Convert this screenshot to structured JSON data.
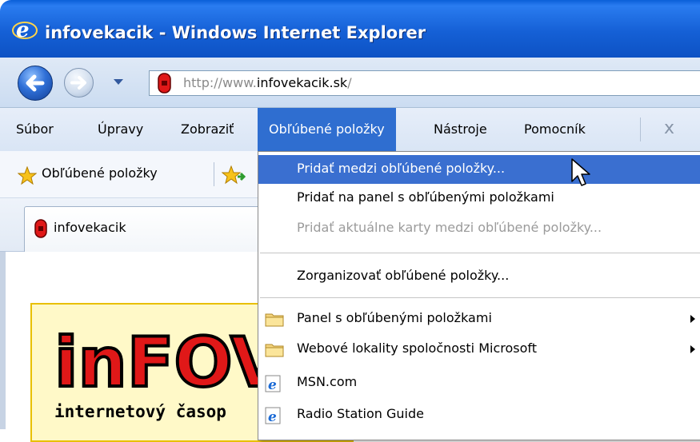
{
  "window": {
    "title": "infovekacik - Windows Internet Explorer"
  },
  "address": {
    "prefix": "http://www.",
    "host": "infovekacik.sk",
    "suffix": "/"
  },
  "menubar": {
    "items": [
      "Súbor",
      "Úpravy",
      "Zobraziť",
      "Obľúbené položky",
      "Nástroje",
      "Pomocník"
    ],
    "close_glyph": "x"
  },
  "favbar": {
    "label": "Obľúbené položky"
  },
  "tab": {
    "title": "infovekacik"
  },
  "page": {
    "logo_letters": "inFOV",
    "tagline": "internetový časop"
  },
  "dropdown": {
    "items": [
      {
        "label": "Pridať medzi obľúbené položky...",
        "state": "highlighted"
      },
      {
        "label": "Pridať na panel s obľúbenými položkami",
        "state": "normal"
      },
      {
        "label": "Pridať aktuálne karty medzi obľúbené položky...",
        "state": "disabled"
      },
      {
        "label": "Zorganizovať obľúbené položky...",
        "state": "normal"
      },
      {
        "label": "Panel s obľúbenými položkami",
        "icon": "folder-icon",
        "submenu": true
      },
      {
        "label": "Webové lokality spoločnosti Microsoft",
        "icon": "folder-icon",
        "submenu": true
      },
      {
        "label": "MSN.com",
        "icon": "ie-page-icon"
      },
      {
        "label": "Radio Station Guide",
        "icon": "ie-page-icon"
      }
    ]
  },
  "colors": {
    "titlebar": "#1560d6",
    "menu_highlight": "#3a6fd0",
    "logo_background": "#fff9c8"
  }
}
